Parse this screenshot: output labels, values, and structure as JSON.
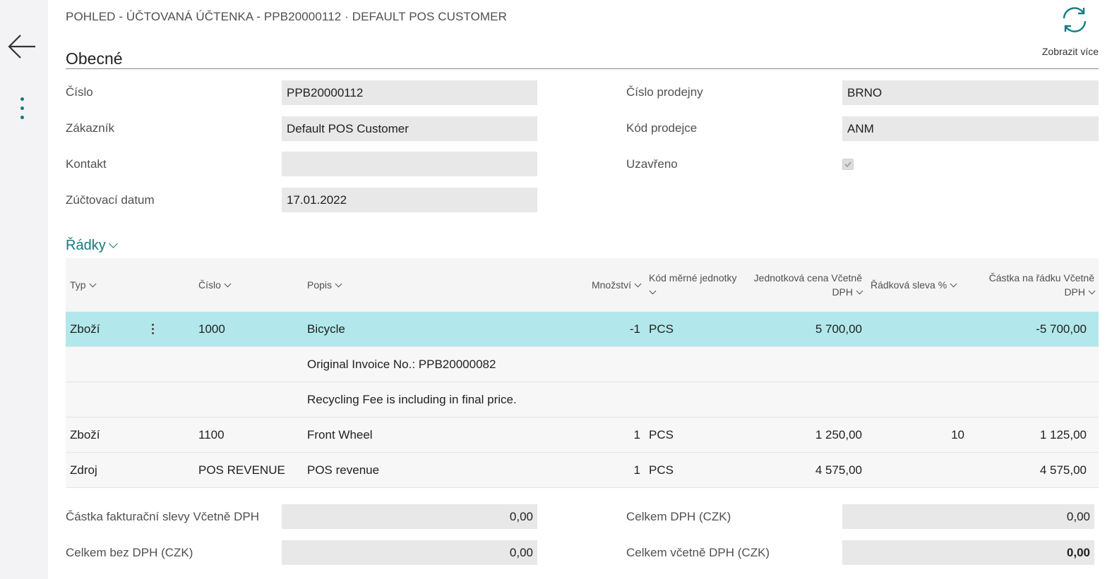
{
  "header": {
    "title": "POHLED - ÚČTOVANÁ ÚČTENKA - PPB20000112 · DEFAULT POS CUSTOMER",
    "more_label": "Zobrazit více"
  },
  "icons": {
    "back": "arrow-left-icon",
    "menu": "kebab-menu-icon",
    "refresh": "refresh-icon"
  },
  "colors": {
    "accent": "#107c7e",
    "selected_row": "#b2e8eb",
    "field_bg": "#e8e8e8"
  },
  "general": {
    "heading": "Obecné",
    "number": {
      "label": "Číslo",
      "value": "PPB20000112"
    },
    "customer": {
      "label": "Zákazník",
      "value": "Default POS Customer"
    },
    "contact": {
      "label": "Kontakt",
      "value": ""
    },
    "posting_date": {
      "label": "Zúčtovací datum",
      "value": "17.01.2022"
    },
    "store_no": {
      "label": "Číslo prodejny",
      "value": "BRNO"
    },
    "salesperson": {
      "label": "Kód prodejce",
      "value": "ANM"
    },
    "closed": {
      "label": "Uzavřeno",
      "checked": true
    }
  },
  "lines": {
    "heading": "Řádky",
    "columns": {
      "type": "Typ",
      "number": "Číslo",
      "description": "Popis",
      "quantity": "Množství",
      "uom": "Kód měrné jednotky",
      "unit_price": "Jednotková cena Včetně DPH",
      "discount": "Řádková sleva %",
      "amount": "Částka na řádku Včetně DPH"
    },
    "rows": [
      {
        "type": "Zboží",
        "number": "1000",
        "description": "Bicycle",
        "quantity": "-1",
        "uom": "PCS",
        "unit_price": "5 700,00",
        "discount": "",
        "amount": "-5 700,00"
      },
      {
        "type": "",
        "number": "",
        "description": "Original Invoice No.: PPB20000082",
        "quantity": "",
        "uom": "",
        "unit_price": "",
        "discount": "",
        "amount": ""
      },
      {
        "type": "",
        "number": "",
        "description": "Recycling Fee is including in final price.",
        "quantity": "",
        "uom": "",
        "unit_price": "",
        "discount": "",
        "amount": ""
      },
      {
        "type": "Zboží",
        "number": "1100",
        "description": "Front Wheel",
        "quantity": "1",
        "uom": "PCS",
        "unit_price": "1 250,00",
        "discount": "10",
        "amount": "1 125,00"
      },
      {
        "type": "Zdroj",
        "number": "POS REVENUE",
        "description": "POS revenue",
        "quantity": "1",
        "uom": "PCS",
        "unit_price": "4 575,00",
        "discount": "",
        "amount": "4 575,00"
      }
    ]
  },
  "totals": {
    "invoice_discount": {
      "label": "Částka fakturační slevy Včetně DPH",
      "value": "0,00"
    },
    "total_excl_vat": {
      "label": "Celkem bez DPH (CZK)",
      "value": "0,00"
    },
    "total_vat": {
      "label": "Celkem DPH (CZK)",
      "value": "0,00"
    },
    "total_incl_vat": {
      "label": "Celkem včetně DPH (CZK)",
      "value": "0,00"
    }
  }
}
